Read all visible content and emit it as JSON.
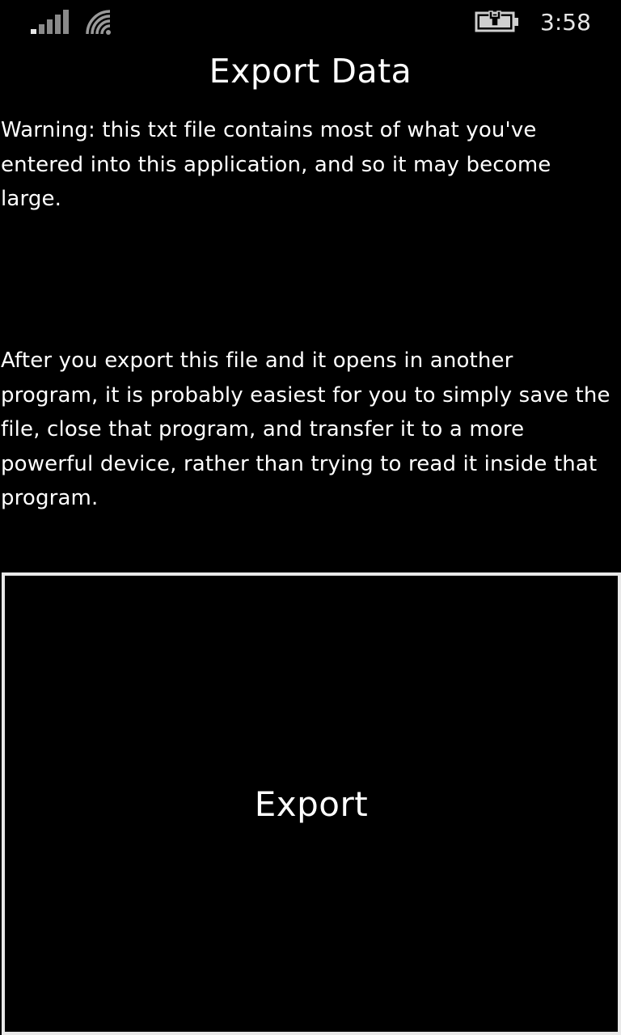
{
  "status_bar": {
    "time": "3:58",
    "signal_icon": "cell-signal-icon",
    "wifi_icon": "wifi-icon",
    "battery_icon": "battery-charging-icon"
  },
  "page": {
    "title": "Export Data",
    "warning": "Warning: this txt file contains most of what you've entered into this application, and so it may become large.",
    "instructions": "After you export this file and it opens in another program, it is probably easiest for you to simply save the file, close that program, and transfer it to a more powerful device, rather than trying to read it inside that program."
  },
  "actions": {
    "export_label": "Export"
  },
  "colors": {
    "background": "#000000",
    "foreground": "#ffffff",
    "button_border": "#e9e9e9",
    "status_dim": "#8a8a8a"
  }
}
